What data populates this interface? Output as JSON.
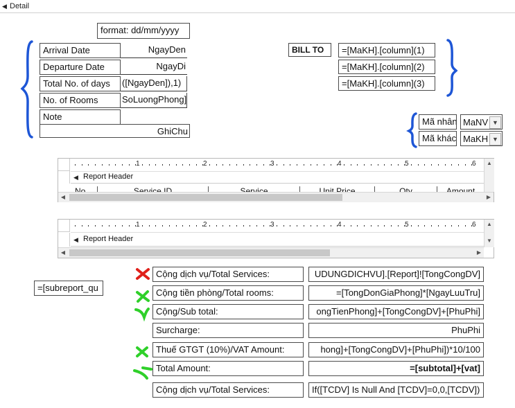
{
  "section": {
    "name": "Detail"
  },
  "format_box": "format: dd/mm/yyyy",
  "left_fields": [
    {
      "label": "Arrival Date",
      "value": "NgayDen"
    },
    {
      "label": "Departure Date",
      "value": "NgayDi"
    },
    {
      "label": "Total No. of days",
      "value": "([NgayDen]),1)"
    },
    {
      "label": "No. of Rooms",
      "value": "SoLuongPhong]"
    },
    {
      "label": "Note",
      "value": "GhiChu"
    }
  ],
  "bill_to": {
    "label": "BILL TO",
    "lines": [
      "=[MaKH].[column](1)",
      "=[MaKH].[column](2)",
      "=[MaKH].[column](3)"
    ]
  },
  "staff": [
    {
      "label": "Mã nhân",
      "value": "MaNV"
    },
    {
      "label": "Mã khách",
      "value": "MaKH"
    }
  ],
  "subreport1": {
    "ruler": [
      "1",
      "2",
      "3",
      "4",
      "5",
      "6"
    ],
    "header_label": "Report Header",
    "columns": [
      "No",
      "Service ID",
      "Service",
      "Unit Price",
      "Qty",
      "Amount"
    ]
  },
  "subreport2": {
    "ruler": [
      "1",
      "2",
      "3",
      "4",
      "5",
      "6"
    ],
    "header_label": "Report Header"
  },
  "subreport_ref": "=[subreport_qu",
  "totals": [
    {
      "label": "Cộng dịch vụ/Total Services:",
      "expr": "UDUNGDICHVU].[Report]![TongCongDV]",
      "mark": "cross"
    },
    {
      "label": "Cộng tiền phòng/Total rooms:",
      "expr": "=[TongDonGiaPhong]*[NgayLuuTru]",
      "mark": "cross"
    },
    {
      "label": "Cộng/Sub total:",
      "expr": "ongTienPhong]+[TongCongDV]+[PhuPhi]",
      "mark": "check"
    },
    {
      "label": "Surcharge:",
      "expr": "PhuPhi",
      "mark": ""
    },
    {
      "label": "Thuế GTGT (10%)/VAT Amount:",
      "expr": "hong]+[TongCongDV]+[PhuPhi])*10/100",
      "mark": "cross"
    },
    {
      "label": "Total Amount:",
      "expr": "=[subtotal]+[vat]",
      "mark": "check"
    },
    {
      "label": "Cộng dịch vụ/Total Services:",
      "expr": "If([TCDV] Is Null And [TCDV]=0,0,[TCDV])",
      "mark": ""
    }
  ],
  "colors": {
    "brace_blue": "#1e56d6",
    "red_mark": "#e0201a",
    "green_mark": "#2fd02a"
  }
}
